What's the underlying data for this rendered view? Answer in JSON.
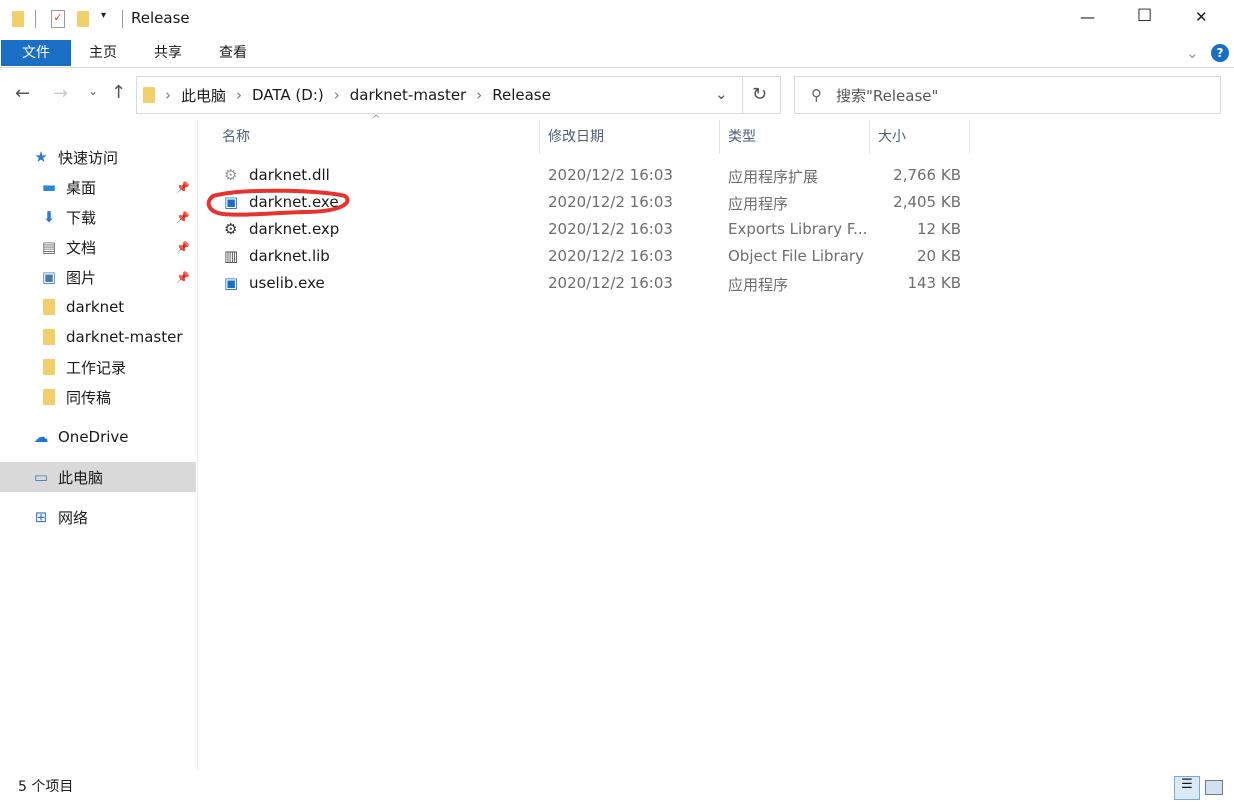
{
  "window": {
    "title": "Release",
    "controls": {
      "minimize": "—",
      "maximize": "☐",
      "close": "✕"
    }
  },
  "ribbon": {
    "tabs": [
      "文件",
      "主页",
      "共享",
      "查看"
    ],
    "accent": "#1a6fc4"
  },
  "nav": {
    "breadcrumb": [
      "此电脑",
      "DATA (D:)",
      "darknet-master",
      "Release"
    ],
    "search_placeholder": "搜索\"Release\""
  },
  "sidebar": {
    "items": [
      {
        "label": "快速访问",
        "icon": "star-icon",
        "pinned": false
      },
      {
        "label": "桌面",
        "icon": "desktop-icon",
        "pinned": true
      },
      {
        "label": "下载",
        "icon": "download-icon",
        "pinned": true
      },
      {
        "label": "文档",
        "icon": "document-icon",
        "pinned": true
      },
      {
        "label": "图片",
        "icon": "pictures-icon",
        "pinned": true
      },
      {
        "label": "darknet",
        "icon": "folder-icon",
        "pinned": false
      },
      {
        "label": "darknet-master",
        "icon": "folder-icon",
        "pinned": false
      },
      {
        "label": "工作记录",
        "icon": "folder-icon",
        "pinned": false
      },
      {
        "label": "同传稿",
        "icon": "folder-icon",
        "pinned": false
      },
      {
        "label": "OneDrive",
        "icon": "cloud-icon",
        "pinned": false
      },
      {
        "label": "此电脑",
        "icon": "computer-icon",
        "pinned": false,
        "selected": true
      },
      {
        "label": "网络",
        "icon": "network-icon",
        "pinned": false
      }
    ]
  },
  "columns": [
    "名称",
    "修改日期",
    "类型",
    "大小"
  ],
  "files": [
    {
      "name": "darknet.dll",
      "date": "2020/12/2 16:03",
      "type": "应用程序扩展",
      "size": "2,766 KB",
      "icon": "dll-icon"
    },
    {
      "name": "darknet.exe",
      "date": "2020/12/2 16:03",
      "type": "应用程序",
      "size": "2,405 KB",
      "icon": "exe-icon",
      "annotated": true
    },
    {
      "name": "darknet.exp",
      "date": "2020/12/2 16:03",
      "type": "Exports Library F...",
      "size": "12 KB",
      "icon": "gear-icon"
    },
    {
      "name": "darknet.lib",
      "date": "2020/12/2 16:03",
      "type": "Object File Library",
      "size": "20 KB",
      "icon": "library-icon"
    },
    {
      "name": "uselib.exe",
      "date": "2020/12/2 16:03",
      "type": "应用程序",
      "size": "143 KB",
      "icon": "exe-icon"
    }
  ],
  "status": {
    "count": "5 个项目"
  }
}
